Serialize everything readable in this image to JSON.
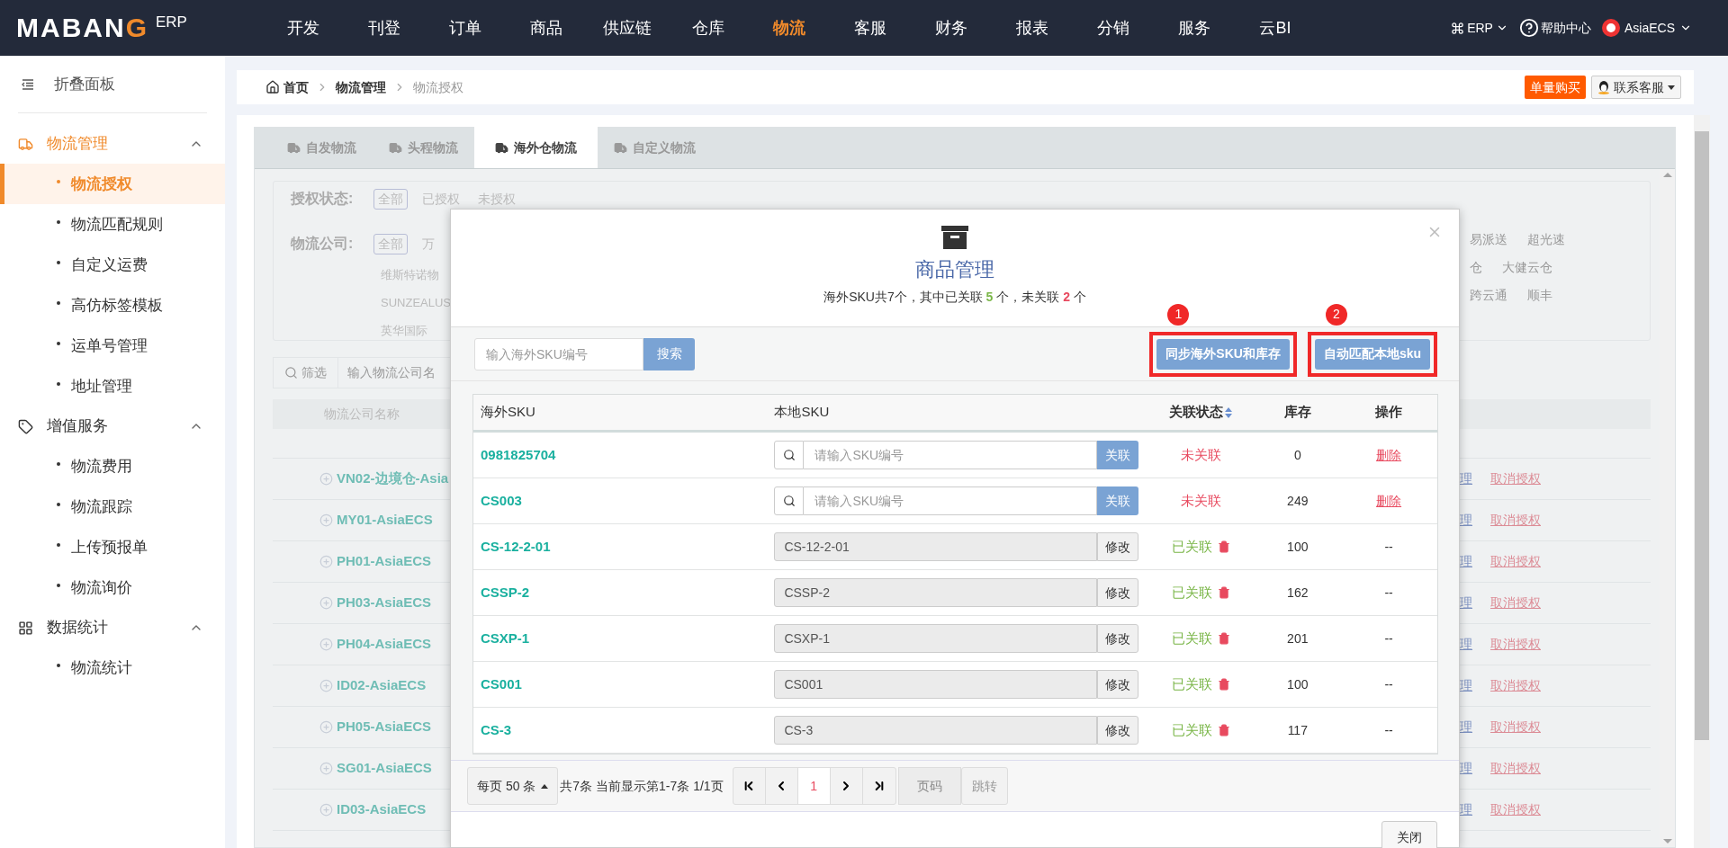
{
  "top_nav": {
    "logo": "MABANG",
    "logo_suffix": "ERP",
    "items": [
      {
        "label": "开发",
        "selected": false
      },
      {
        "label": "刊登",
        "selected": false
      },
      {
        "label": "订单",
        "selected": false
      },
      {
        "label": "商品",
        "selected": false
      },
      {
        "label": "供应链",
        "selected": false
      },
      {
        "label": "仓库",
        "selected": false
      },
      {
        "label": "物流",
        "selected": true
      },
      {
        "label": "客服",
        "selected": false
      },
      {
        "label": "财务",
        "selected": false
      },
      {
        "label": "报表",
        "selected": false
      },
      {
        "label": "分销",
        "selected": false
      },
      {
        "label": "服务",
        "selected": false
      },
      {
        "label": "云BI",
        "selected": false
      }
    ],
    "erp_menu": "ERP",
    "help": "帮助中心",
    "user": "AsiaECS"
  },
  "sidebar": {
    "collapse": "折叠面板",
    "groups": [
      {
        "label": "物流管理",
        "selected": true,
        "expanded": true,
        "items": [
          {
            "label": "物流授权",
            "selected": true
          },
          {
            "label": "物流匹配规则",
            "selected": false
          },
          {
            "label": "自定义运费",
            "selected": false
          },
          {
            "label": "高仿标签模板",
            "selected": false
          },
          {
            "label": "运单号管理",
            "selected": false
          },
          {
            "label": "地址管理",
            "selected": false
          }
        ]
      },
      {
        "label": "增值服务",
        "selected": false,
        "expanded": true,
        "items": [
          {
            "label": "物流费用",
            "selected": false
          },
          {
            "label": "物流跟踪",
            "selected": false
          },
          {
            "label": "上传预报单",
            "selected": false
          },
          {
            "label": "物流询价",
            "selected": false
          }
        ]
      },
      {
        "label": "数据统计",
        "selected": false,
        "expanded": true,
        "items": [
          {
            "label": "物流统计",
            "selected": false
          }
        ]
      }
    ]
  },
  "breadcrumb": [
    "首页",
    "物流管理",
    "物流授权"
  ],
  "buy_button": "单量购买",
  "service_button": "联系客服",
  "tabs": [
    {
      "label": "自发物流",
      "selected": false
    },
    {
      "label": "头程物流",
      "selected": false
    },
    {
      "label": "海外仓物流",
      "selected": true
    },
    {
      "label": "自定义物流",
      "selected": false
    }
  ],
  "filters": {
    "status_label": "授权状态:",
    "status_options": [
      {
        "label": "全部",
        "selected": true
      },
      {
        "label": "已授权",
        "selected": false
      },
      {
        "label": "未授权",
        "selected": false
      }
    ],
    "company_label": "物流公司:",
    "company_options": [
      {
        "label": "全部",
        "selected": true
      },
      {
        "label": "万",
        "selected": false
      }
    ],
    "company_rows_left": [
      "维斯特诺物",
      "SUNZEALUS",
      "英华国际"
    ],
    "company_rows_right": [
      [
        "易派送",
        "超光速"
      ],
      [
        "仓",
        "大健云仓"
      ],
      [
        "跨云通",
        "顺丰"
      ]
    ]
  },
  "search": {
    "filter_label": "筛选",
    "placeholder": "输入物流公司名"
  },
  "background_table": {
    "column": "物流公司名称",
    "rows": [
      {
        "name": "VN02-边境仓-Asia",
        "manage": "理",
        "revoke": "取消授权"
      },
      {
        "name": "MY01-AsiaECS",
        "manage": "理",
        "revoke": "取消授权"
      },
      {
        "name": "PH01-AsiaECS",
        "manage": "理",
        "revoke": "取消授权"
      },
      {
        "name": "PH03-AsiaECS",
        "manage": "理",
        "revoke": "取消授权"
      },
      {
        "name": "PH04-AsiaECS",
        "manage": "理",
        "revoke": "取消授权"
      },
      {
        "name": "ID02-AsiaECS",
        "manage": "理",
        "revoke": "取消授权"
      },
      {
        "name": "PH05-AsiaECS",
        "manage": "理",
        "revoke": "取消授权"
      },
      {
        "name": "SG01-AsiaECS",
        "manage": "理",
        "revoke": "取消授权"
      },
      {
        "name": "ID03-AsiaECS",
        "manage": "理",
        "revoke": "取消授权"
      }
    ]
  },
  "modal": {
    "title": "商品管理",
    "summary": {
      "prefix": "海外SKU共7个，其中已关联",
      "linked": "5",
      "middle": "个，未关联",
      "unlinked": "2",
      "suffix": "个"
    },
    "search_placeholder": "输入海外SKU编号",
    "search_button": "搜索",
    "actions": [
      {
        "label": "同步海外SKU和库存",
        "marker": "1"
      },
      {
        "label": "自动匹配本地sku",
        "marker": "2"
      }
    ],
    "columns": [
      "海外SKU",
      "本地SKU",
      "关联状态",
      "库存",
      "操作"
    ],
    "rows": [
      {
        "kind": "unlinked",
        "sku": "0981825704",
        "placeholder": "请输入SKU编号",
        "button": "关联",
        "status": "未关联",
        "stock": "0",
        "action": "删除"
      },
      {
        "kind": "unlinked",
        "sku": "CS003",
        "placeholder": "请输入SKU编号",
        "button": "关联",
        "status": "未关联",
        "stock": "249",
        "action": "删除"
      },
      {
        "kind": "linked",
        "sku": "CS-12-2-01",
        "value": "CS-12-2-01",
        "button": "修改",
        "status": "已关联",
        "stock": "100",
        "action": "--"
      },
      {
        "kind": "linked",
        "sku": "CSSP-2",
        "value": "CSSP-2",
        "button": "修改",
        "status": "已关联",
        "stock": "162",
        "action": "--"
      },
      {
        "kind": "linked",
        "sku": "CSXP-1",
        "value": "CSXP-1",
        "button": "修改",
        "status": "已关联",
        "stock": "201",
        "action": "--"
      },
      {
        "kind": "linked",
        "sku": "CS001",
        "value": "CS001",
        "button": "修改",
        "status": "已关联",
        "stock": "100",
        "action": "--"
      },
      {
        "kind": "linked",
        "sku": "CS-3",
        "value": "CS-3",
        "button": "修改",
        "status": "已关联",
        "stock": "117",
        "action": "--"
      }
    ],
    "page_size": "每页 50 条",
    "page_info": "共7条 当前显示第1-7条 1/1页",
    "current_page": "1",
    "page_placeholder": "页码",
    "jump_button": "跳转",
    "close_button": "关闭"
  }
}
